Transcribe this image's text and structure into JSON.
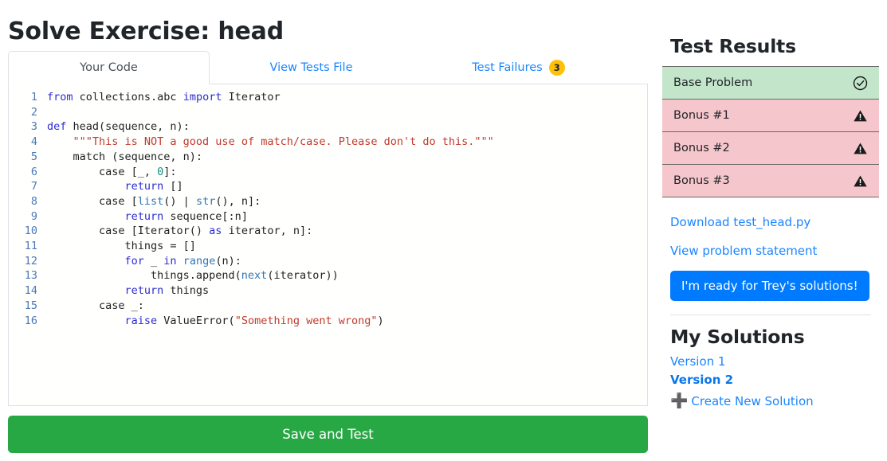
{
  "page_title": "Solve Exercise: head",
  "tabs": [
    {
      "label": "Your Code",
      "active": true,
      "name": "tab-your-code"
    },
    {
      "label": "View Tests File",
      "active": false,
      "name": "tab-view-tests-file"
    },
    {
      "label": "Test Failures",
      "active": false,
      "name": "tab-test-failures",
      "badge": "3"
    }
  ],
  "editor": {
    "language": "python",
    "line_numbers": [
      "1",
      "2",
      "3",
      "4",
      "5",
      "6",
      "7",
      "8",
      "9",
      "10",
      "11",
      "12",
      "13",
      "14",
      "15",
      "16"
    ],
    "lines": [
      "from collections.abc import Iterator",
      "",
      "def head(sequence, n):",
      "    \"\"\"This is NOT a good use of match/case. Please don't do this.\"\"\"",
      "    match (sequence, n):",
      "        case [_, 0]:",
      "            return []",
      "        case [list() | str(), n]:",
      "            return sequence[:n]",
      "        case [Iterator() as iterator, n]:",
      "            things = []",
      "            for _ in range(n):",
      "                things.append(next(iterator))",
      "            return things",
      "        case _:",
      "            raise ValueError(\"Something went wrong\")"
    ]
  },
  "save_button_label": "Save and Test",
  "test_results": {
    "heading": "Test Results",
    "items": [
      {
        "label": "Base Problem",
        "status": "pass",
        "icon": "check-circle-icon"
      },
      {
        "label": "Bonus #1",
        "status": "fail",
        "icon": "warning-triangle-icon"
      },
      {
        "label": "Bonus #2",
        "status": "fail",
        "icon": "warning-triangle-icon"
      },
      {
        "label": "Bonus #3",
        "status": "fail",
        "icon": "warning-triangle-icon"
      }
    ]
  },
  "links": {
    "download": "Download test_head.py",
    "view_problem": "View problem statement",
    "trey_button": "I'm ready for Trey's solutions!"
  },
  "my_solutions": {
    "heading": "My Solutions",
    "versions": [
      {
        "label": "Version 1",
        "current": false
      },
      {
        "label": "Version 2",
        "current": true
      }
    ],
    "create_label": "Create New Solution",
    "create_icon": "plus-icon"
  },
  "colors": {
    "accent_blue": "#1a85ff",
    "primary_button": "#007bff",
    "success_green": "#28a745",
    "pass_row": "#c3e6cb",
    "fail_row": "#f5c6cb",
    "badge_yellow": "#ffc107"
  }
}
